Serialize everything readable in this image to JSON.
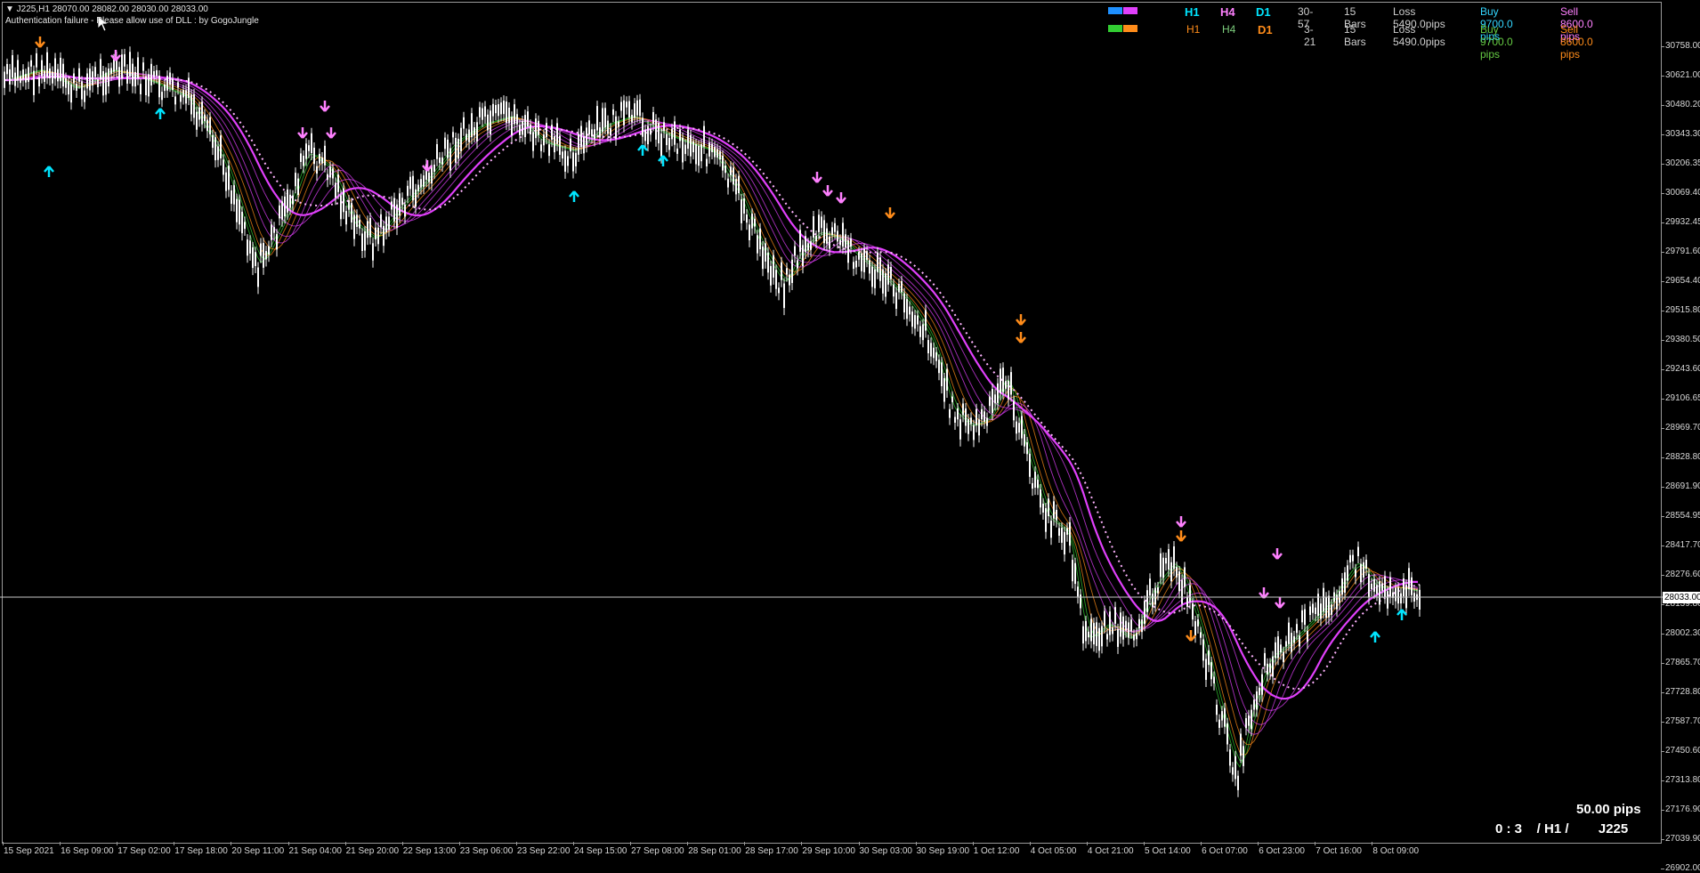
{
  "header": {
    "symbol_line": "▼ J225,H1  28070.00 28082.00 28030.00 28033.00",
    "warning_line": "Authentication failure - Please allow use of DLL : by GogoJungle"
  },
  "panel": {
    "rows": [
      {
        "swatches": [
          "#1e90ff",
          "#e040fb"
        ],
        "tf": [
          {
            "label": "H1",
            "color": "#00e5ff"
          },
          {
            "label": "H4",
            "color": "#ff80ff"
          },
          {
            "label": "D1",
            "color": "#00e5ff"
          }
        ],
        "range": "30-57",
        "bars": "15 Bars",
        "loss": "Loss 5490.0pips",
        "buy": "Buy 9700.0 pips",
        "sell": "Sell 8600.0 pips",
        "buy_color": "#33d6ff",
        "sell_color": "#ff80ff"
      },
      {
        "swatches": [
          "#32cd32",
          "#ff8c1a"
        ],
        "tf": [
          {
            "label": "H1",
            "color": "#ff8c1a"
          },
          {
            "label": "H4",
            "color": "#7ccd7c"
          },
          {
            "label": "D1",
            "color": "#ff8c1a"
          }
        ],
        "range": "3-21",
        "bars": "15 Bars",
        "loss": "Loss 5490.0pips",
        "buy": "Buy 9700.0 pips",
        "sell": "Sell 8600.0 pips",
        "buy_color": "#66cc44",
        "sell_color": "#ff8c1a"
      }
    ]
  },
  "price_axis": {
    "labels": [
      "30758.00",
      "30621.00",
      "30480.20",
      "30343.30",
      "30206.35",
      "30069.40",
      "29932.45",
      "29791.60",
      "29654.40",
      "29515.80",
      "29380.50",
      "29243.60",
      "29106.65",
      "28969.70",
      "28828.80",
      "28691.90",
      "28554.95",
      "28417.70",
      "28276.60",
      "28139.80",
      "28002.30",
      "27865.70",
      "27728.80",
      "27587.70",
      "27450.60",
      "27313.80",
      "27176.90",
      "27039.90",
      "26902.00"
    ],
    "current_price": "28033.00"
  },
  "time_axis": {
    "labels": [
      "15 Sep 2021",
      "16 Sep 09:00",
      "17 Sep 02:00",
      "17 Sep 18:00",
      "20 Sep 11:00",
      "21 Sep 04:00",
      "21 Sep 20:00",
      "22 Sep 13:00",
      "23 Sep 06:00",
      "23 Sep 22:00",
      "24 Sep 15:00",
      "27 Sep 08:00",
      "28 Sep 01:00",
      "28 Sep 17:00",
      "29 Sep 10:00",
      "30 Sep 03:00",
      "30 Sep 19:00",
      "1 Oct 12:00",
      "4 Oct 05:00",
      "4 Oct 21:00",
      "5 Oct 14:00",
      "6 Oct 07:00",
      "6 Oct 23:00",
      "7 Oct 16:00",
      "8 Oct 09:00"
    ]
  },
  "footer": {
    "pips": "50.00 pips",
    "status": "0 : 3    / H1 /        J225"
  },
  "colors": {
    "magenta": "#e040fb",
    "orange": "#ff8c1a",
    "green": "#32cd32",
    "blue": "#1e90ff",
    "candle": "#ffffff",
    "grid_line": "#c8c8c8"
  },
  "icons": [
    "arrow-up-icon",
    "arrow-down-icon",
    "cursor-icon"
  ]
}
